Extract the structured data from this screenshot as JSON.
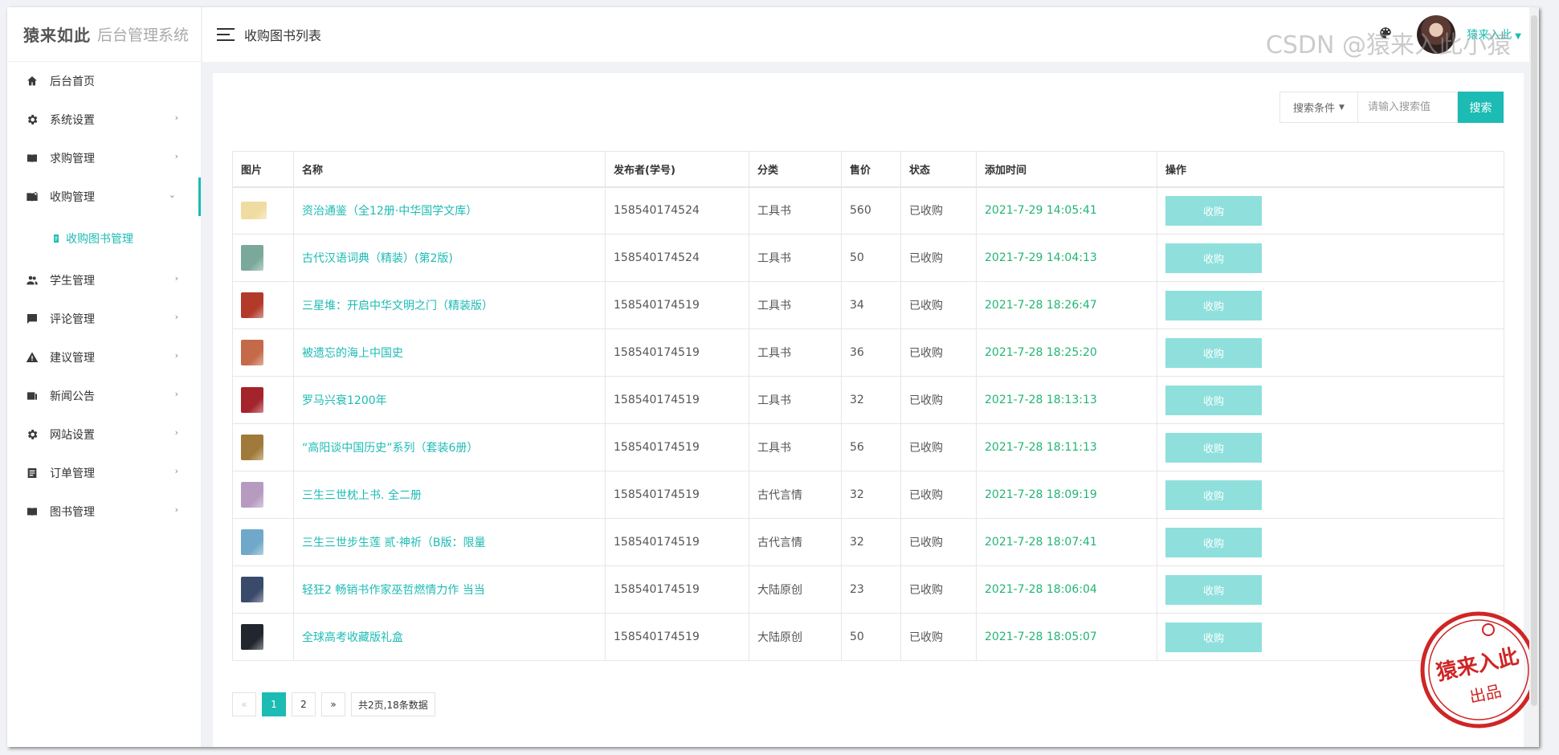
{
  "sidebar": {
    "brand": "猿来如此",
    "system_name": "后台管理系统",
    "items": [
      {
        "label": "后台首页",
        "icon": "home-icon"
      },
      {
        "label": "系统设置",
        "icon": "gear-icon"
      },
      {
        "label": "求购管理",
        "icon": "book-icon"
      },
      {
        "label": "收购管理",
        "icon": "book-open-icon"
      },
      {
        "label": "学生管理",
        "icon": "people-icon"
      },
      {
        "label": "评论管理",
        "icon": "comment-icon"
      },
      {
        "label": "建议管理",
        "icon": "warning-icon"
      },
      {
        "label": "新闻公告",
        "icon": "news-icon"
      },
      {
        "label": "网站设置",
        "icon": "gear-icon"
      },
      {
        "label": "订单管理",
        "icon": "document-icon"
      },
      {
        "label": "图书管理",
        "icon": "book-icon"
      }
    ],
    "sub_item": {
      "label": "收购图书管理",
      "icon": "clipboard-icon"
    }
  },
  "header": {
    "title": "收购图书列表",
    "username": "猿来入此"
  },
  "search": {
    "condition_label": "搜索条件",
    "placeholder": "请输入搜索值",
    "button_label": "搜索"
  },
  "table": {
    "columns": [
      "图片",
      "名称",
      "发布者(学号)",
      "分类",
      "售价",
      "状态",
      "添加时间",
      "操作"
    ],
    "action_label": "收购",
    "rows": [
      {
        "name": "资治通鉴（全12册·中华国学文库）",
        "publisher": "158540174524",
        "category": "工具书",
        "price": "560",
        "status": "已收购",
        "time": "2021-7-29 14:05:41",
        "thumb_color": "#f0dca0"
      },
      {
        "name": "古代汉语词典（精装）(第2版)",
        "publisher": "158540174524",
        "category": "工具书",
        "price": "50",
        "status": "已收购",
        "time": "2021-7-29 14:04:13",
        "thumb_color": "#7aa89a"
      },
      {
        "name": "三星堆：开启中华文明之门（精装版）",
        "publisher": "158540174519",
        "category": "工具书",
        "price": "34",
        "status": "已收购",
        "time": "2021-7-28 18:26:47",
        "thumb_color": "#b33a2a"
      },
      {
        "name": "被遗忘的海上中国史",
        "publisher": "158540174519",
        "category": "工具书",
        "price": "36",
        "status": "已收购",
        "time": "2021-7-28 18:25:20",
        "thumb_color": "#c46a4a"
      },
      {
        "name": "罗马兴衰1200年",
        "publisher": "158540174519",
        "category": "工具书",
        "price": "32",
        "status": "已收购",
        "time": "2021-7-28 18:13:13",
        "thumb_color": "#a5232a"
      },
      {
        "name": "“高阳谈中国历史”系列（套装6册）",
        "publisher": "158540174519",
        "category": "工具书",
        "price": "56",
        "status": "已收购",
        "time": "2021-7-28 18:11:13",
        "thumb_color": "#a07a3a"
      },
      {
        "name": "三生三世枕上书. 全二册",
        "publisher": "158540174519",
        "category": "古代言情",
        "price": "32",
        "status": "已收购",
        "time": "2021-7-28 18:09:19",
        "thumb_color": "#b69ac0"
      },
      {
        "name": "三生三世步生莲 贰·神祈（B版：限量",
        "publisher": "158540174519",
        "category": "古代言情",
        "price": "32",
        "status": "已收购",
        "time": "2021-7-28 18:07:41",
        "thumb_color": "#6fa8c8"
      },
      {
        "name": "轻狂2 畅销书作家巫哲燃情力作 当当",
        "publisher": "158540174519",
        "category": "大陆原创",
        "price": "23",
        "status": "已收购",
        "time": "2021-7-28 18:06:04",
        "thumb_color": "#3a4a6a"
      },
      {
        "name": "全球高考收藏版礼盒",
        "publisher": "158540174519",
        "category": "大陆原创",
        "price": "50",
        "status": "已收购",
        "time": "2021-7-28 18:05:07",
        "thumb_color": "#22262e"
      }
    ]
  },
  "pagination": {
    "prev": "«",
    "pages": [
      "1",
      "2"
    ],
    "current": "1",
    "next": "»",
    "info": "共2页,18条数据"
  },
  "watermark": "CSDN @猿来入此小猿",
  "stamp": {
    "main": "猿来入此",
    "sub": "出品"
  },
  "colors": {
    "accent": "#1cbbb4",
    "time_green": "#22b573",
    "button_light": "#8fe0dc"
  }
}
